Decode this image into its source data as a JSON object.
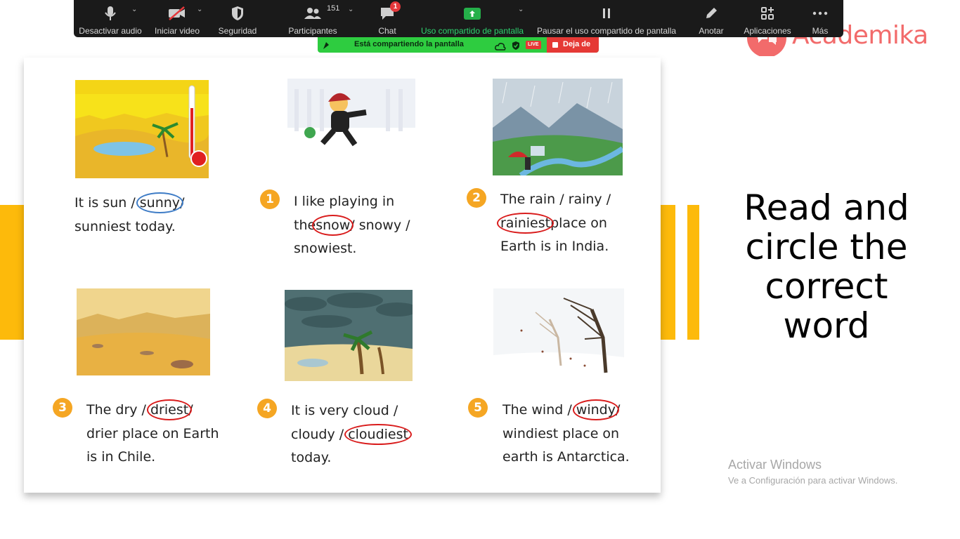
{
  "toolbar": {
    "audio_label": "Desactivar audio",
    "video_label": "Iniciar video",
    "security_label": "Seguridad",
    "participants_label": "Participantes",
    "participants_count": "151",
    "chat_label": "Chat",
    "chat_badge": "1",
    "share_label": "Uso compartido de pantalla",
    "pause_label": "Pausar el uso compartido de pantalla",
    "annotate_label": "Anotar",
    "apps_label": "Aplicaciones",
    "more_label": "Más"
  },
  "share_banner": {
    "text": "Está compartiendo la pantalla",
    "live": "LIVE",
    "stop_label": "Deja de"
  },
  "brand": {
    "name": "Academika"
  },
  "exercise": {
    "example": {
      "line1_pre": "It is sun /",
      "circled": "sunny",
      "line1_post": "/",
      "line2": "sunniest today."
    },
    "items": [
      {
        "number": "1",
        "line1": "I like playing in",
        "line2_pre": "the",
        "circled": "snow",
        "line2_post": "/ snowy /",
        "line3": "snowiest."
      },
      {
        "number": "2",
        "line1": "The rain / rainy /",
        "circled": "rainiest",
        "line2_post": "place on",
        "line3": "Earth is in India."
      },
      {
        "number": "3",
        "line1_pre": "The dry /",
        "circled": "driest",
        "line1_post": "/",
        "line2": "drier place on Earth",
        "line3": "is in Chile."
      },
      {
        "number": "4",
        "line1": "It is very cloud /",
        "line2_pre": "cloudy /",
        "circled": "cloudiest",
        "line3": "today."
      },
      {
        "number": "5",
        "line1_pre": "The wind /",
        "circled": "windy",
        "line1_post": "/",
        "line2": "windiest place on",
        "line3": "earth is Antarctica."
      }
    ]
  },
  "instruction": {
    "line1": "Read and",
    "line2": "circle the",
    "line3": "correct",
    "line4": "word"
  },
  "windows_activation": {
    "title": "Activar Windows",
    "subtitle": "Ve a Configuración para activar Windows."
  }
}
